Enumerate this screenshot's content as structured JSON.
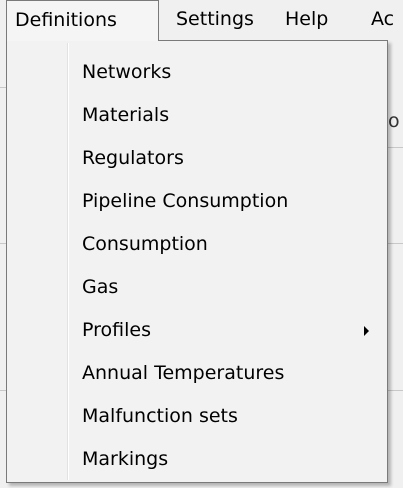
{
  "menubar": {
    "items": [
      {
        "label": "Definitions"
      },
      {
        "label": "Settings"
      },
      {
        "label": "Help"
      },
      {
        "label": "Ac"
      }
    ]
  },
  "background": {
    "ghost_text": "o"
  },
  "dropdown": {
    "items": [
      {
        "label": "Networks"
      },
      {
        "label": "Materials"
      },
      {
        "label": "Regulators"
      },
      {
        "label": "Pipeline Consumption"
      },
      {
        "label": "Consumption"
      },
      {
        "label": "Gas"
      },
      {
        "label": "Profiles",
        "submenu_icon": "submenu-arrow-icon"
      },
      {
        "label": "Annual Temperatures"
      },
      {
        "label": "Malfunction sets"
      },
      {
        "label": "Markings"
      }
    ]
  }
}
